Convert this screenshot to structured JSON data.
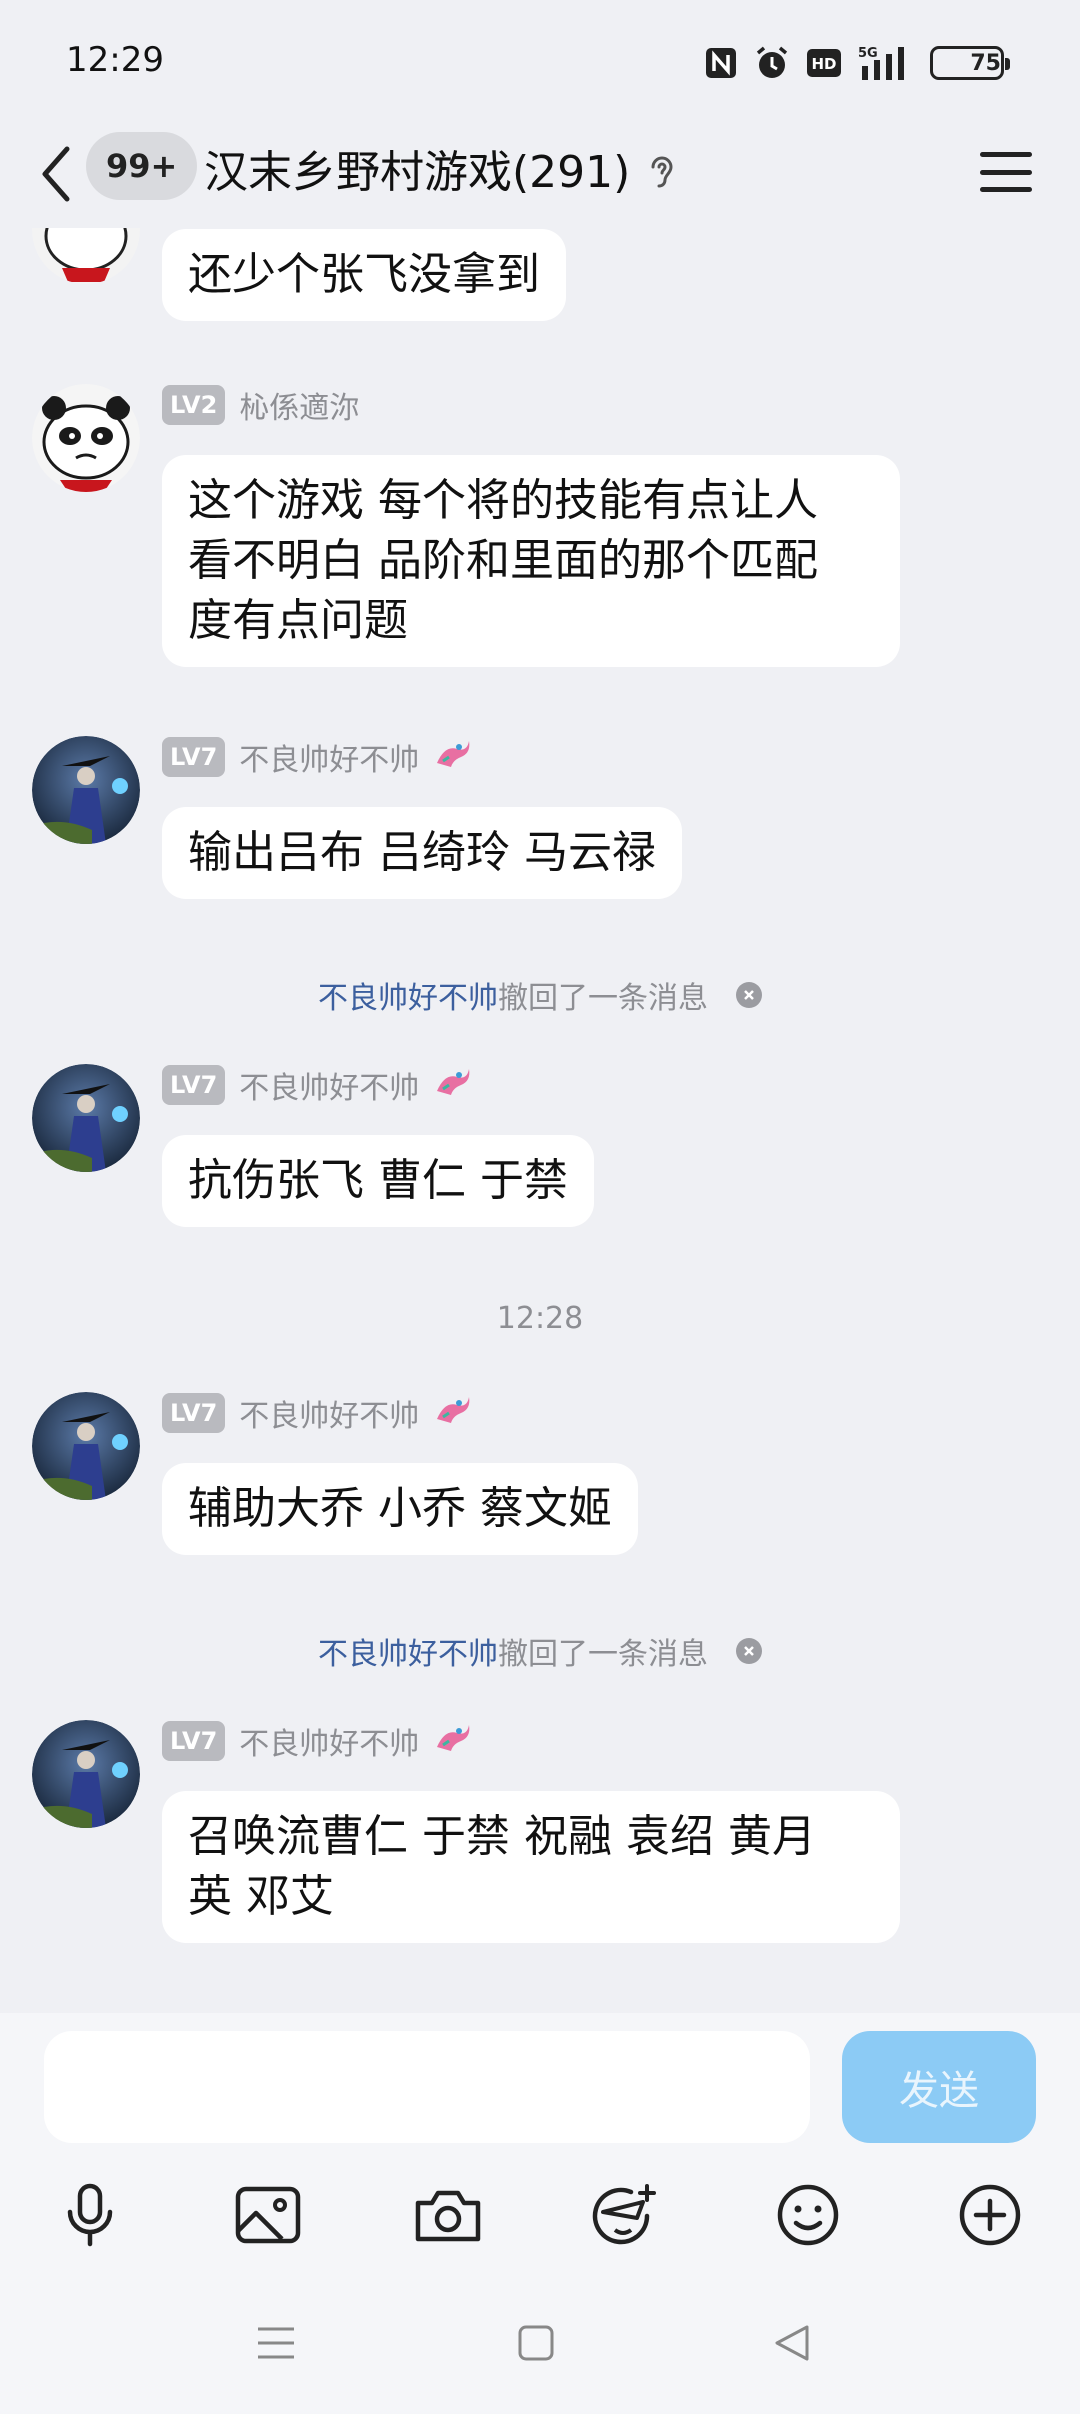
{
  "status_bar": {
    "time": "12:29",
    "battery": "75",
    "battery_level": 0.75,
    "network": "5G"
  },
  "title_bar": {
    "unread_badge": "99+",
    "title": "汉末乡野村游戏(291)"
  },
  "messages": [
    {
      "type": "text",
      "text": "还少个张飞没拿到"
    },
    {
      "type": "user",
      "level": "LV2",
      "nick": "杺係適沵",
      "text_lines": [
        "这个游戏 每个将的技能有点让人",
        "看不明白  品阶和里面的那个匹配",
        "度有点问题"
      ]
    },
    {
      "type": "user",
      "level": "LV7",
      "nick": "不良帅好不帅",
      "text_lines": [
        "输出吕布 吕绮玲 马云禄"
      ]
    },
    {
      "type": "system",
      "who": "不良帅好不帅",
      "action": "撤回了一条消息"
    },
    {
      "type": "user",
      "level": "LV7",
      "nick": "不良帅好不帅",
      "text_lines": [
        "抗伤张飞 曹仁 于禁"
      ]
    },
    {
      "type": "time",
      "text": "12:28"
    },
    {
      "type": "user",
      "level": "LV7",
      "nick": "不良帅好不帅",
      "text_lines": [
        "辅助大乔 小乔 蔡文姬"
      ]
    },
    {
      "type": "system",
      "who": "不良帅好不帅",
      "action": "撤回了一条消息"
    },
    {
      "type": "user",
      "level": "LV7",
      "nick": "不良帅好不帅",
      "text_lines": [
        "召唤流曹仁 于禁 祝融 袁绍 黄月",
        "英 邓艾"
      ]
    }
  ],
  "input_bar": {
    "placeholder": "",
    "send_label": "发送"
  },
  "tools": [
    "microphone-icon",
    "image-icon",
    "camera-icon",
    "sticker-icon",
    "emoji-icon",
    "plus-icon"
  ],
  "colors": {
    "background": "#eff0f4",
    "send_button": "#8ccbf5",
    "recall_name": "#3c5f9e",
    "level_badge": "#b9babf"
  }
}
